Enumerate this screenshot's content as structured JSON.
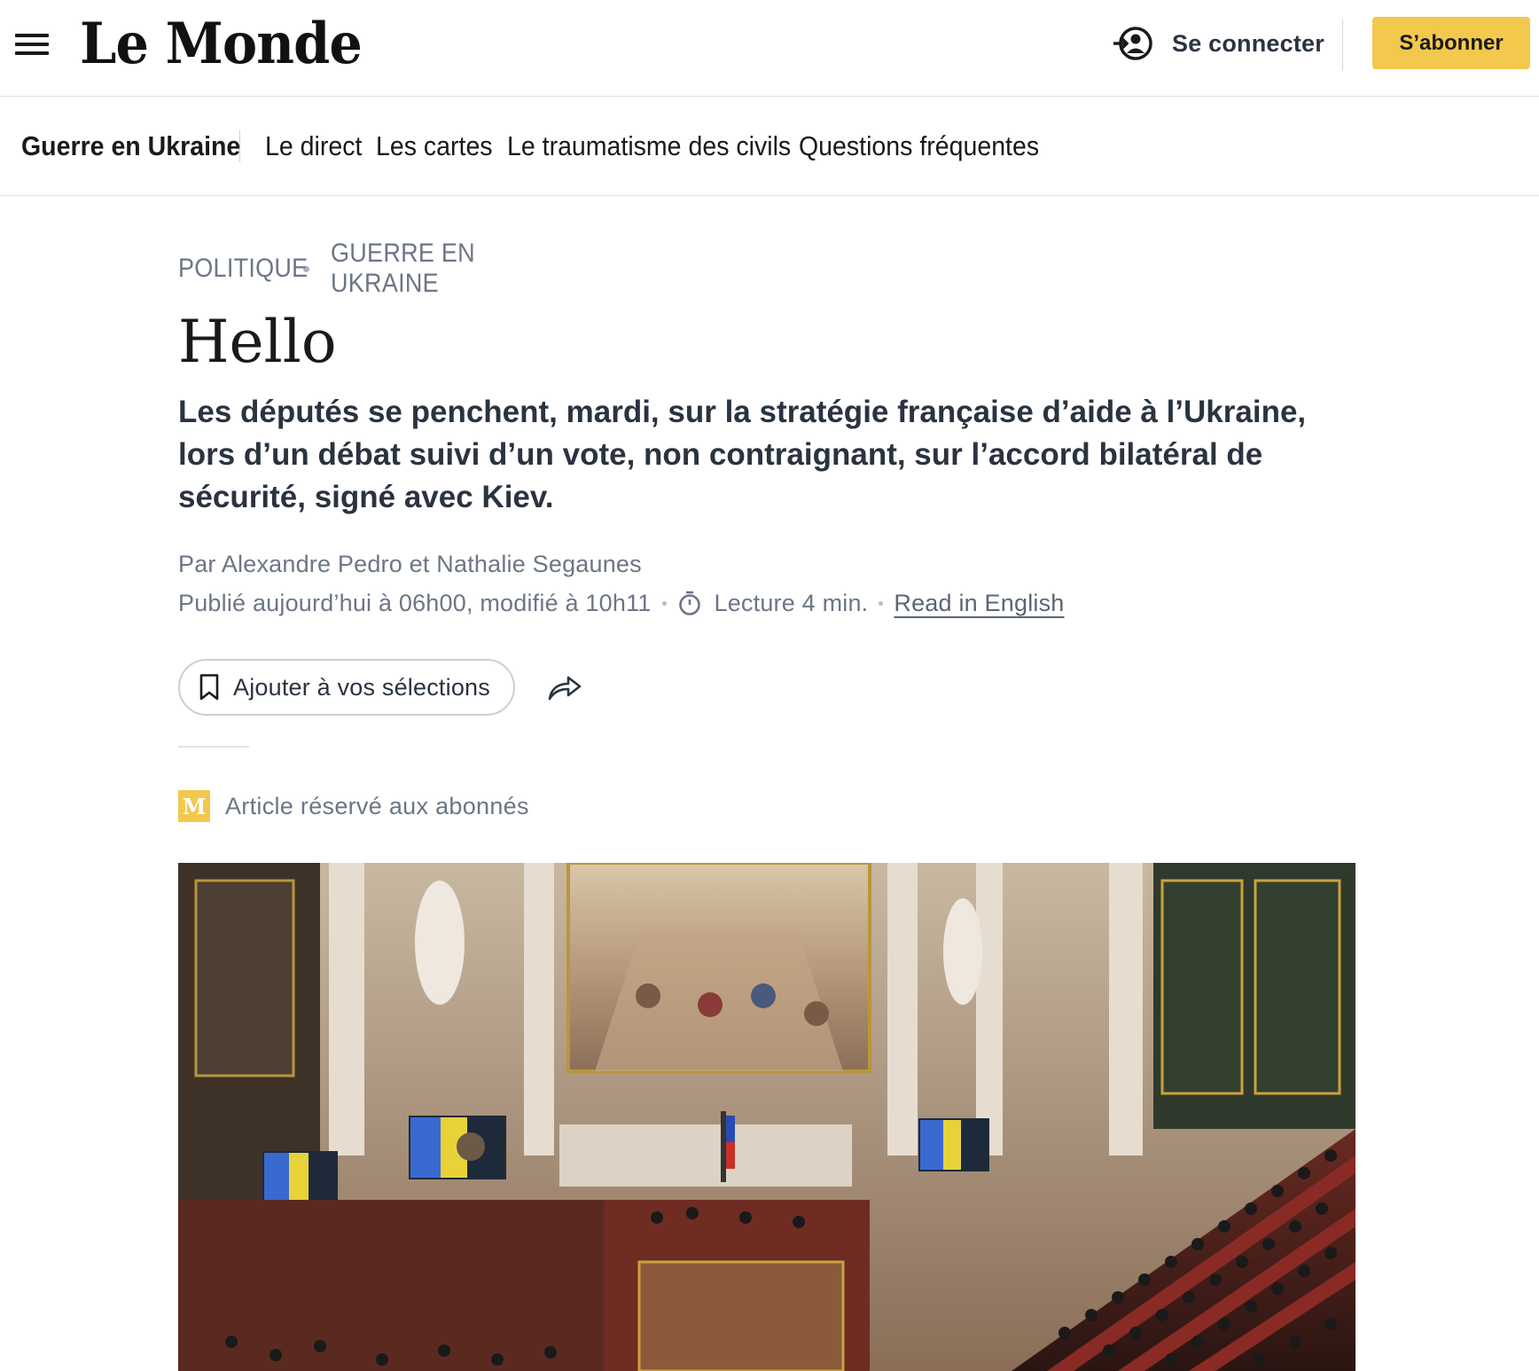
{
  "header": {
    "logo": "Le Monde",
    "login_label": "Se connecter",
    "subscribe_label": "S’abonner",
    "subscribe_color": "#f2c94c"
  },
  "subnav": {
    "title": "Guerre en Ukraine",
    "links": [
      "Le direct",
      "Les cartes",
      "Le traumatisme des civils",
      "Questions fréquentes"
    ]
  },
  "article": {
    "kicker": [
      "Politique",
      "Guerre en Ukraine"
    ],
    "title": "Hello",
    "lede": "Les députés se penchent, mardi, sur la stratégie française d’aide à l’Ukraine, lors d’un débat suivi d’un vote, non contraignant, sur l’accord bilatéral de sécurité, signé avec Kiev.",
    "byline": "Par Alexandre Pedro et Nathalie Segaunes",
    "published": "Publié aujourd’hui à 06h00, modifié à 10h11",
    "reading_time": "Lecture 4 min.",
    "read_in_english": "Read in English",
    "save_label": "Ajouter à vos sélections",
    "premium_badge": "M",
    "premium_label": "Article réservé aux abonnés"
  },
  "icons": {
    "menu": "hamburger-menu-icon",
    "login": "user-login-icon",
    "timer": "stopwatch-icon",
    "bookmark": "bookmark-icon",
    "share": "share-arrow-icon"
  },
  "hero_image": {
    "subject": "french-national-assembly-chamber-photo"
  }
}
